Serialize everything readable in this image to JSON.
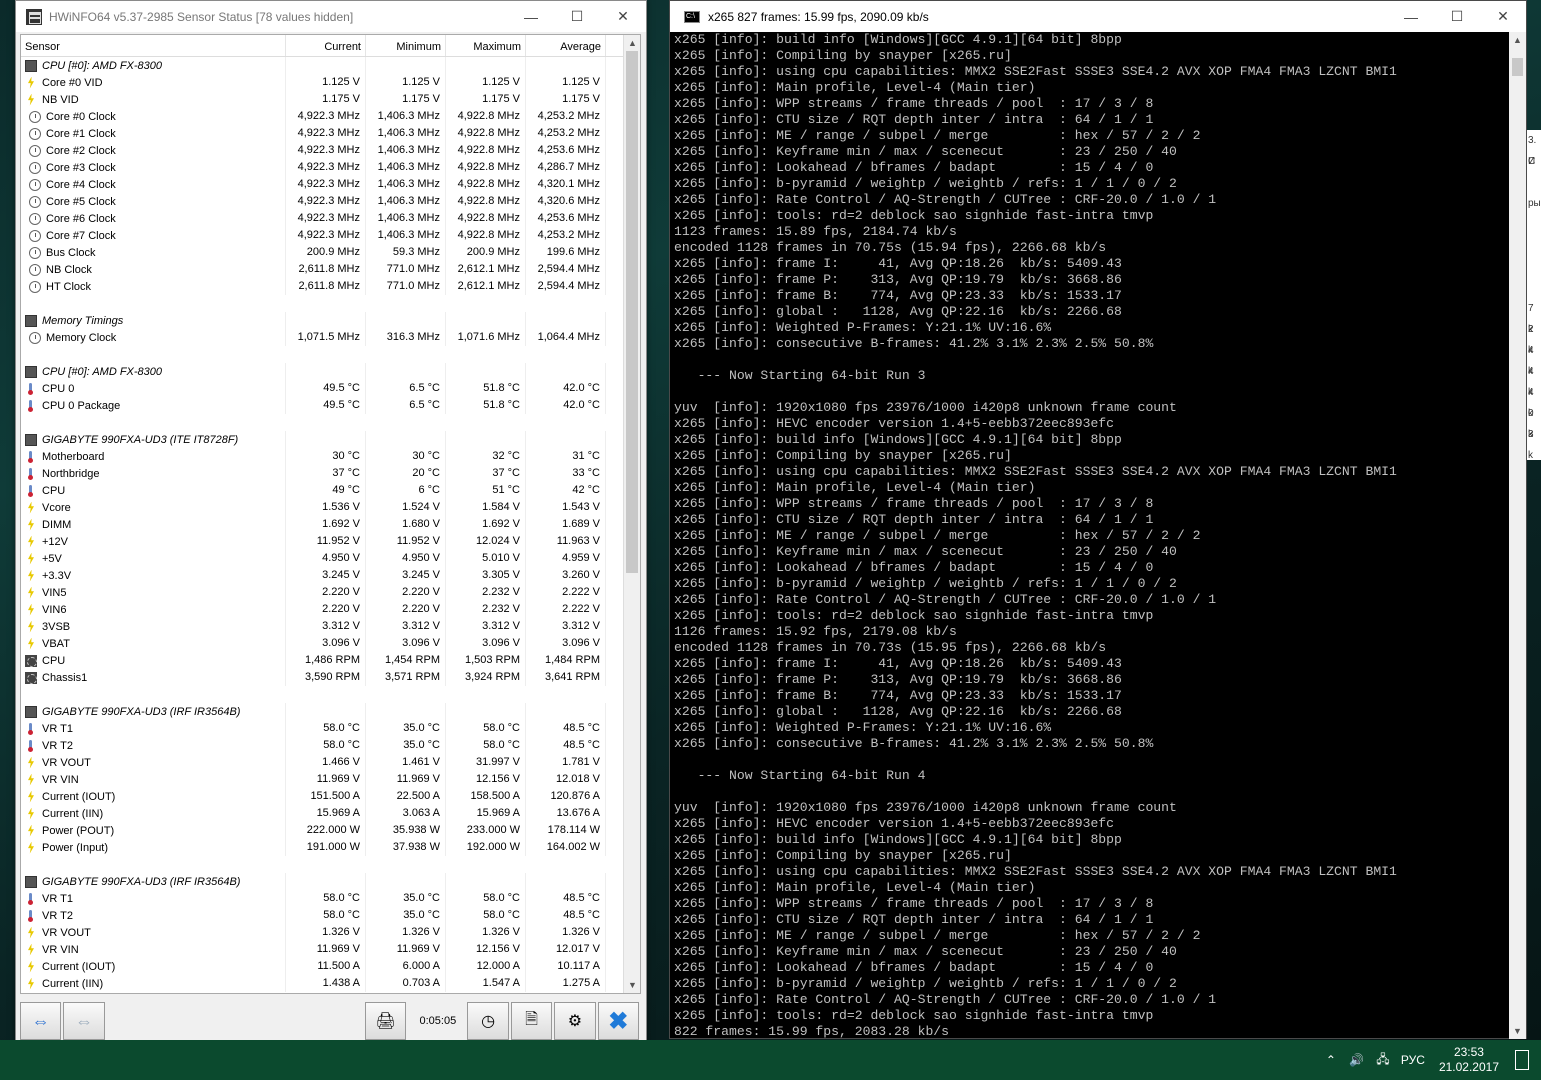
{
  "hwinfo": {
    "title": "HWiNFO64 v5.37-2985 Sensor Status [78 values hidden]",
    "columns": [
      "Sensor",
      "Current",
      "Minimum",
      "Maximum",
      "Average"
    ],
    "timer": "0:05:05",
    "rows": [
      {
        "type": "group",
        "icon": "chip-icon",
        "name": "CPU [#0]: AMD FX-8300"
      },
      {
        "icon": "voltage-icon",
        "name": "Core #0 VID",
        "cur": "1.125 V",
        "min": "1.125 V",
        "max": "1.125 V",
        "avg": "1.125 V"
      },
      {
        "icon": "voltage-icon",
        "name": "NB VID",
        "cur": "1.175 V",
        "min": "1.175 V",
        "max": "1.175 V",
        "avg": "1.175 V"
      },
      {
        "icon": "clock-icon",
        "name": "Core #0 Clock",
        "cur": "4,922.3 MHz",
        "min": "1,406.3 MHz",
        "max": "4,922.8 MHz",
        "avg": "4,253.2 MHz"
      },
      {
        "icon": "clock-icon",
        "name": "Core #1 Clock",
        "cur": "4,922.3 MHz",
        "min": "1,406.3 MHz",
        "max": "4,922.8 MHz",
        "avg": "4,253.2 MHz"
      },
      {
        "icon": "clock-icon",
        "name": "Core #2 Clock",
        "cur": "4,922.3 MHz",
        "min": "1,406.3 MHz",
        "max": "4,922.8 MHz",
        "avg": "4,253.6 MHz"
      },
      {
        "icon": "clock-icon",
        "name": "Core #3 Clock",
        "cur": "4,922.3 MHz",
        "min": "1,406.3 MHz",
        "max": "4,922.8 MHz",
        "avg": "4,286.7 MHz"
      },
      {
        "icon": "clock-icon",
        "name": "Core #4 Clock",
        "cur": "4,922.3 MHz",
        "min": "1,406.3 MHz",
        "max": "4,922.8 MHz",
        "avg": "4,320.1 MHz"
      },
      {
        "icon": "clock-icon",
        "name": "Core #5 Clock",
        "cur": "4,922.3 MHz",
        "min": "1,406.3 MHz",
        "max": "4,922.8 MHz",
        "avg": "4,320.6 MHz"
      },
      {
        "icon": "clock-icon",
        "name": "Core #6 Clock",
        "cur": "4,922.3 MHz",
        "min": "1,406.3 MHz",
        "max": "4,922.8 MHz",
        "avg": "4,253.6 MHz"
      },
      {
        "icon": "clock-icon",
        "name": "Core #7 Clock",
        "cur": "4,922.3 MHz",
        "min": "1,406.3 MHz",
        "max": "4,922.8 MHz",
        "avg": "4,253.2 MHz"
      },
      {
        "icon": "clock-icon",
        "name": "Bus Clock",
        "cur": "200.9 MHz",
        "min": "59.3 MHz",
        "max": "200.9 MHz",
        "avg": "199.6 MHz"
      },
      {
        "icon": "clock-icon",
        "name": "NB Clock",
        "cur": "2,611.8 MHz",
        "min": "771.0 MHz",
        "max": "2,612.1 MHz",
        "avg": "2,594.4 MHz"
      },
      {
        "icon": "clock-icon",
        "name": "HT Clock",
        "cur": "2,611.8 MHz",
        "min": "771.0 MHz",
        "max": "2,612.1 MHz",
        "avg": "2,594.4 MHz"
      },
      {
        "type": "blank"
      },
      {
        "type": "group",
        "icon": "chip-icon",
        "name": "Memory Timings"
      },
      {
        "icon": "clock-icon",
        "name": "Memory Clock",
        "cur": "1,071.5 MHz",
        "min": "316.3 MHz",
        "max": "1,071.6 MHz",
        "avg": "1,064.4 MHz"
      },
      {
        "type": "blank"
      },
      {
        "type": "group",
        "icon": "chip-icon",
        "name": "CPU [#0]: AMD FX-8300"
      },
      {
        "icon": "temperature-icon",
        "name": "CPU 0",
        "cur": "49.5 °C",
        "min": "6.5 °C",
        "max": "51.8 °C",
        "avg": "42.0 °C"
      },
      {
        "icon": "temperature-icon",
        "name": "CPU 0 Package",
        "cur": "49.5 °C",
        "min": "6.5 °C",
        "max": "51.8 °C",
        "avg": "42.0 °C"
      },
      {
        "type": "blank"
      },
      {
        "type": "group",
        "icon": "chip-icon",
        "name": "GIGABYTE 990FXA-UD3 (ITE IT8728F)"
      },
      {
        "icon": "temperature-icon",
        "name": "Motherboard",
        "cur": "30 °C",
        "min": "30 °C",
        "max": "32 °C",
        "avg": "31 °C"
      },
      {
        "icon": "temperature-icon",
        "name": "Northbridge",
        "cur": "37 °C",
        "min": "20 °C",
        "max": "37 °C",
        "avg": "33 °C"
      },
      {
        "icon": "temperature-icon",
        "name": "CPU",
        "cur": "49 °C",
        "min": "6 °C",
        "max": "51 °C",
        "avg": "42 °C"
      },
      {
        "icon": "voltage-icon",
        "name": "Vcore",
        "cur": "1.536 V",
        "min": "1.524 V",
        "max": "1.584 V",
        "avg": "1.543 V"
      },
      {
        "icon": "voltage-icon",
        "name": "DIMM",
        "cur": "1.692 V",
        "min": "1.680 V",
        "max": "1.692 V",
        "avg": "1.689 V"
      },
      {
        "icon": "voltage-icon",
        "name": "+12V",
        "cur": "11.952 V",
        "min": "11.952 V",
        "max": "12.024 V",
        "avg": "11.963 V"
      },
      {
        "icon": "voltage-icon",
        "name": "+5V",
        "cur": "4.950 V",
        "min": "4.950 V",
        "max": "5.010 V",
        "avg": "4.959 V"
      },
      {
        "icon": "voltage-icon",
        "name": "+3.3V",
        "cur": "3.245 V",
        "min": "3.245 V",
        "max": "3.305 V",
        "avg": "3.260 V"
      },
      {
        "icon": "voltage-icon",
        "name": "VIN5",
        "cur": "2.220 V",
        "min": "2.220 V",
        "max": "2.232 V",
        "avg": "2.222 V"
      },
      {
        "icon": "voltage-icon",
        "name": "VIN6",
        "cur": "2.220 V",
        "min": "2.220 V",
        "max": "2.232 V",
        "avg": "2.222 V"
      },
      {
        "icon": "voltage-icon",
        "name": "3VSB",
        "cur": "3.312 V",
        "min": "3.312 V",
        "max": "3.312 V",
        "avg": "3.312 V"
      },
      {
        "icon": "voltage-icon",
        "name": "VBAT",
        "cur": "3.096 V",
        "min": "3.096 V",
        "max": "3.096 V",
        "avg": "3.096 V"
      },
      {
        "icon": "fan-icon",
        "name": "CPU",
        "cur": "1,486 RPM",
        "min": "1,454 RPM",
        "max": "1,503 RPM",
        "avg": "1,484 RPM"
      },
      {
        "icon": "fan-icon",
        "name": "Chassis1",
        "cur": "3,590 RPM",
        "min": "3,571 RPM",
        "max": "3,924 RPM",
        "avg": "3,641 RPM"
      },
      {
        "type": "blank"
      },
      {
        "type": "group",
        "icon": "chip-icon",
        "name": "GIGABYTE 990FXA-UD3 (IRF IR3564B)"
      },
      {
        "icon": "temperature-icon",
        "name": "VR T1",
        "cur": "58.0 °C",
        "min": "35.0 °C",
        "max": "58.0 °C",
        "avg": "48.5 °C"
      },
      {
        "icon": "temperature-icon",
        "name": "VR T2",
        "cur": "58.0 °C",
        "min": "35.0 °C",
        "max": "58.0 °C",
        "avg": "48.5 °C"
      },
      {
        "icon": "voltage-icon",
        "name": "VR VOUT",
        "cur": "1.466 V",
        "min": "1.461 V",
        "max": "31.997 V",
        "avg": "1.781 V"
      },
      {
        "icon": "voltage-icon",
        "name": "VR VIN",
        "cur": "11.969 V",
        "min": "11.969 V",
        "max": "12.156 V",
        "avg": "12.018 V"
      },
      {
        "icon": "voltage-icon",
        "name": "Current (IOUT)",
        "cur": "151.500 A",
        "min": "22.500 A",
        "max": "158.500 A",
        "avg": "120.876 A"
      },
      {
        "icon": "voltage-icon",
        "name": "Current (IIN)",
        "cur": "15.969 A",
        "min": "3.063 A",
        "max": "15.969 A",
        "avg": "13.676 A"
      },
      {
        "icon": "voltage-icon",
        "name": "Power (POUT)",
        "cur": "222.000 W",
        "min": "35.938 W",
        "max": "233.000 W",
        "avg": "178.114 W"
      },
      {
        "icon": "voltage-icon",
        "name": "Power (Input)",
        "cur": "191.000 W",
        "min": "37.938 W",
        "max": "192.000 W",
        "avg": "164.002 W"
      },
      {
        "type": "blank"
      },
      {
        "type": "group",
        "icon": "chip-icon",
        "name": "GIGABYTE 990FXA-UD3 (IRF IR3564B)"
      },
      {
        "icon": "temperature-icon",
        "name": "VR T1",
        "cur": "58.0 °C",
        "min": "35.0 °C",
        "max": "58.0 °C",
        "avg": "48.5 °C"
      },
      {
        "icon": "temperature-icon",
        "name": "VR T2",
        "cur": "58.0 °C",
        "min": "35.0 °C",
        "max": "58.0 °C",
        "avg": "48.5 °C"
      },
      {
        "icon": "voltage-icon",
        "name": "VR VOUT",
        "cur": "1.326 V",
        "min": "1.326 V",
        "max": "1.326 V",
        "avg": "1.326 V"
      },
      {
        "icon": "voltage-icon",
        "name": "VR VIN",
        "cur": "11.969 V",
        "min": "11.969 V",
        "max": "12.156 V",
        "avg": "12.017 V"
      },
      {
        "icon": "voltage-icon",
        "name": "Current (IOUT)",
        "cur": "11.500 A",
        "min": "6.000 A",
        "max": "12.000 A",
        "avg": "10.117 A"
      },
      {
        "icon": "voltage-icon",
        "name": "Current (IIN)",
        "cur": "1.438 A",
        "min": "0.703 A",
        "max": "1.547 A",
        "avg": "1.275 A"
      }
    ]
  },
  "console": {
    "title": "x265 827 frames: 15.99 fps, 2090.09 kb/s",
    "lines": [
      "x265 [info]: build info [Windows][GCC 4.9.1][64 bit] 8bpp",
      "x265 [info]: Compiling by snayper [x265.ru]",
      "x265 [info]: using cpu capabilities: MMX2 SSE2Fast SSSE3 SSE4.2 AVX XOP FMA4 FMA3 LZCNT BMI1",
      "x265 [info]: Main profile, Level-4 (Main tier)",
      "x265 [info]: WPP streams / frame threads / pool  : 17 / 3 / 8",
      "x265 [info]: CTU size / RQT depth inter / intra  : 64 / 1 / 1",
      "x265 [info]: ME / range / subpel / merge         : hex / 57 / 2 / 2",
      "x265 [info]: Keyframe min / max / scenecut       : 23 / 250 / 40",
      "x265 [info]: Lookahead / bframes / badapt        : 15 / 4 / 0",
      "x265 [info]: b-pyramid / weightp / weightb / refs: 1 / 1 / 0 / 2",
      "x265 [info]: Rate Control / AQ-Strength / CUTree : CRF-20.0 / 1.0 / 1",
      "x265 [info]: tools: rd=2 deblock sao signhide fast-intra tmvp",
      "1123 frames: 15.89 fps, 2184.74 kb/s",
      "encoded 1128 frames in 70.75s (15.94 fps), 2266.68 kb/s",
      "x265 [info]: frame I:     41, Avg QP:18.26  kb/s: 5409.43",
      "x265 [info]: frame P:    313, Avg QP:19.79  kb/s: 3668.86",
      "x265 [info]: frame B:    774, Avg QP:23.33  kb/s: 1533.17",
      "x265 [info]: global :   1128, Avg QP:22.16  kb/s: 2266.68",
      "x265 [info]: Weighted P-Frames: Y:21.1% UV:16.6%",
      "x265 [info]: consecutive B-frames: 41.2% 3.1% 2.3% 2.5% 50.8%",
      "",
      "   --- Now Starting 64-bit Run 3",
      "",
      "yuv  [info]: 1920x1080 fps 23976/1000 i420p8 unknown frame count",
      "x265 [info]: HEVC encoder version 1.4+5-eebb372eec893efc",
      "x265 [info]: build info [Windows][GCC 4.9.1][64 bit] 8bpp",
      "x265 [info]: Compiling by snayper [x265.ru]",
      "x265 [info]: using cpu capabilities: MMX2 SSE2Fast SSSE3 SSE4.2 AVX XOP FMA4 FMA3 LZCNT BMI1",
      "x265 [info]: Main profile, Level-4 (Main tier)",
      "x265 [info]: WPP streams / frame threads / pool  : 17 / 3 / 8",
      "x265 [info]: CTU size / RQT depth inter / intra  : 64 / 1 / 1",
      "x265 [info]: ME / range / subpel / merge         : hex / 57 / 2 / 2",
      "x265 [info]: Keyframe min / max / scenecut       : 23 / 250 / 40",
      "x265 [info]: Lookahead / bframes / badapt        : 15 / 4 / 0",
      "x265 [info]: b-pyramid / weightp / weightb / refs: 1 / 1 / 0 / 2",
      "x265 [info]: Rate Control / AQ-Strength / CUTree : CRF-20.0 / 1.0 / 1",
      "x265 [info]: tools: rd=2 deblock sao signhide fast-intra tmvp",
      "1126 frames: 15.92 fps, 2179.08 kb/s",
      "encoded 1128 frames in 70.73s (15.95 fps), 2266.68 kb/s",
      "x265 [info]: frame I:     41, Avg QP:18.26  kb/s: 5409.43",
      "x265 [info]: frame P:    313, Avg QP:19.79  kb/s: 3668.86",
      "x265 [info]: frame B:    774, Avg QP:23.33  kb/s: 1533.17",
      "x265 [info]: global :   1128, Avg QP:22.16  kb/s: 2266.68",
      "x265 [info]: Weighted P-Frames: Y:21.1% UV:16.6%",
      "x265 [info]: consecutive B-frames: 41.2% 3.1% 2.3% 2.5% 50.8%",
      "",
      "   --- Now Starting 64-bit Run 4",
      "",
      "yuv  [info]: 1920x1080 fps 23976/1000 i420p8 unknown frame count",
      "x265 [info]: HEVC encoder version 1.4+5-eebb372eec893efc",
      "x265 [info]: build info [Windows][GCC 4.9.1][64 bit] 8bpp",
      "x265 [info]: Compiling by snayper [x265.ru]",
      "x265 [info]: using cpu capabilities: MMX2 SSE2Fast SSSE3 SSE4.2 AVX XOP FMA4 FMA3 LZCNT BMI1",
      "x265 [info]: Main profile, Level-4 (Main tier)",
      "x265 [info]: WPP streams / frame threads / pool  : 17 / 3 / 8",
      "x265 [info]: CTU size / RQT depth inter / intra  : 64 / 1 / 1",
      "x265 [info]: ME / range / subpel / merge         : hex / 57 / 2 / 2",
      "x265 [info]: Keyframe min / max / scenecut       : 23 / 250 / 40",
      "x265 [info]: Lookahead / bframes / badapt        : 15 / 4 / 0",
      "x265 [info]: b-pyramid / weightp / weightb / refs: 1 / 1 / 0 / 2",
      "x265 [info]: Rate Control / AQ-Strength / CUTree : CRF-20.0 / 1.0 / 1",
      "x265 [info]: tools: rd=2 deblock sao signhide fast-intra tmvp",
      "822 frames: 15.99 fps, 2083.28 kb/s"
    ]
  },
  "background_window": {
    "fragments": [
      "3. С",
      "И",
      "",
      "ры",
      "",
      "",
      "",
      "",
      "7 k",
      "2 k",
      "4 k",
      "4 k",
      "4 k",
      "0 k",
      "3 k"
    ]
  },
  "taskbar": {
    "language": "РУС",
    "time": "23:53",
    "date": "21.02.2017"
  },
  "colors": {
    "console_text": "#c0c0c0",
    "taskbar": "#0b4a2e"
  }
}
